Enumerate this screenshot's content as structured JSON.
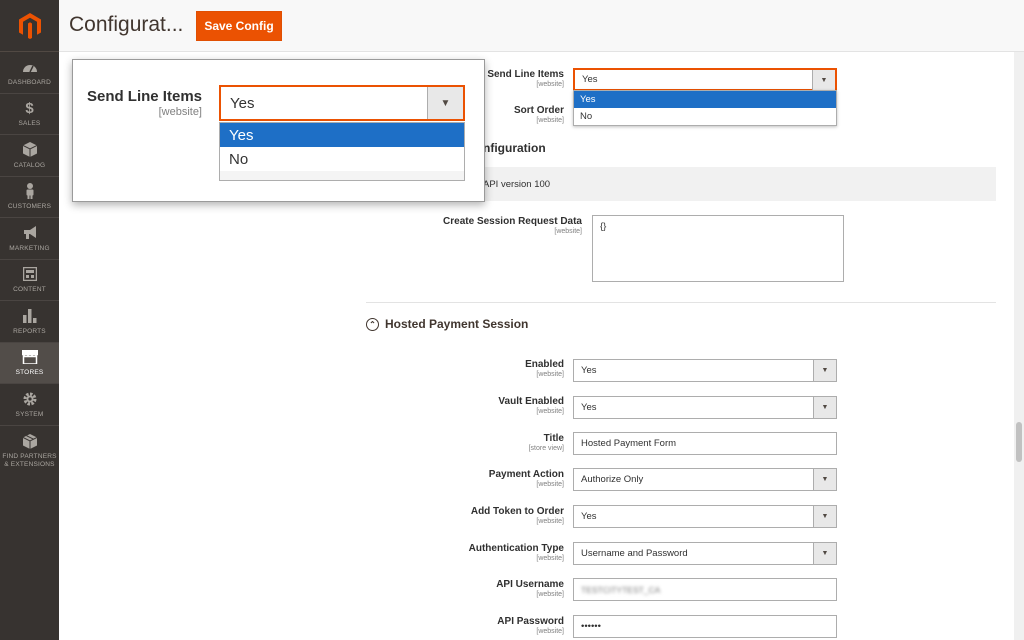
{
  "sidebar": {
    "items": [
      {
        "label": "DASHBOARD",
        "icon": "dashboard-icon"
      },
      {
        "label": "SALES",
        "icon": "dollar-icon"
      },
      {
        "label": "CATALOG",
        "icon": "cube-icon"
      },
      {
        "label": "CUSTOMERS",
        "icon": "person-icon"
      },
      {
        "label": "MARKETING",
        "icon": "megaphone-icon"
      },
      {
        "label": "CONTENT",
        "icon": "layout-icon"
      },
      {
        "label": "REPORTS",
        "icon": "bar-chart-icon"
      },
      {
        "label": "STORES",
        "icon": "store-icon"
      },
      {
        "label": "SYSTEM",
        "icon": "gear-icon"
      },
      {
        "label": "FIND PARTNERS & EXTENSIONS",
        "icon": "box-icon"
      }
    ],
    "active": "STORES"
  },
  "header": {
    "title": "Configurat...",
    "save_label": "Save Config"
  },
  "top_fields": {
    "send_line_items": {
      "label": "Send Line Items",
      "scope": "[website]",
      "value": "Yes",
      "options": [
        "Yes",
        "No"
      ],
      "highlighted": "Yes"
    },
    "sort_order": {
      "label": "Sort Order",
      "scope": "[website]"
    }
  },
  "config_section": {
    "title": "nfiguration",
    "api_text": "API version 100"
  },
  "create_session": {
    "label": "Create Session Request Data",
    "scope": "[website]",
    "value": "{}"
  },
  "hosted_section": {
    "title": "Hosted Payment Session"
  },
  "fields": [
    {
      "label": "Enabled",
      "scope": "[website]",
      "value": "Yes",
      "type": "select"
    },
    {
      "label": "Vault Enabled",
      "scope": "[website]",
      "value": "Yes",
      "type": "select"
    },
    {
      "label": "Title",
      "scope": "[store view]",
      "value": "Hosted Payment Form",
      "type": "input"
    },
    {
      "label": "Payment Action",
      "scope": "[website]",
      "value": "Authorize Only",
      "type": "select"
    },
    {
      "label": "Add Token to Order",
      "scope": "[website]",
      "value": "Yes",
      "type": "select"
    },
    {
      "label": "Authentication Type",
      "scope": "[website]",
      "value": "Username and Password",
      "type": "select"
    },
    {
      "label": "API Username",
      "scope": "[website]",
      "value": "TESTCITYTEST_CA",
      "type": "input"
    },
    {
      "label": "API Password",
      "scope": "[website]",
      "value": "••••••",
      "type": "input"
    }
  ],
  "callout": {
    "label": "Send Line Items",
    "scope": "[website]",
    "value": "Yes",
    "options": [
      "Yes",
      "No"
    ]
  },
  "colors": {
    "accent": "#eb5202",
    "sidebar": "#373330",
    "highlight": "#1e6fc6"
  }
}
